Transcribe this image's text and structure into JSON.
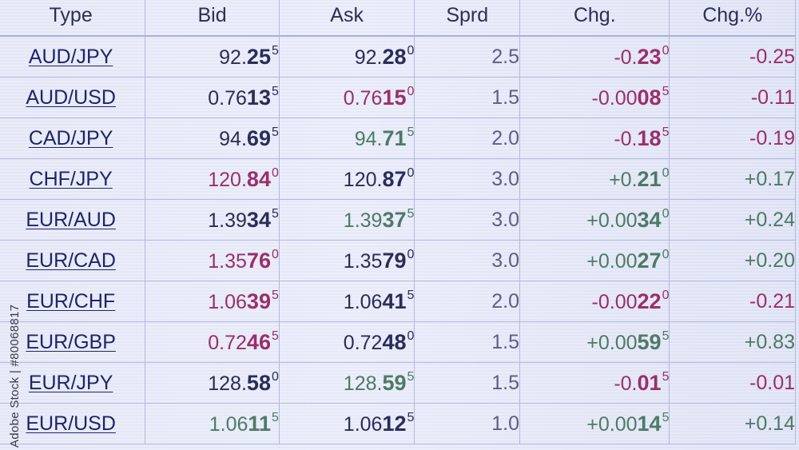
{
  "columns": [
    "Type",
    "Bid",
    "Ask",
    "Sprd",
    "Chg.",
    "Chg.%"
  ],
  "colors": {
    "dark": "#2a2d58",
    "magenta": "#9a2f6a",
    "green": "#4d7a66",
    "grey": "#5c5f84"
  },
  "rows": [
    {
      "type": "AUD/JPY",
      "bid": {
        "pre": "92.",
        "big": "25",
        "sup": "5",
        "color": "dark"
      },
      "ask": {
        "pre": "92.",
        "big": "28",
        "sup": "0",
        "color": "dark"
      },
      "sprd": "2.5",
      "chg": {
        "pre": "-0.",
        "big": "23",
        "sup": "0",
        "color": "magenta"
      },
      "pct": {
        "text": "-0.25",
        "color": "magenta"
      }
    },
    {
      "type": "AUD/USD",
      "bid": {
        "pre": "0.76",
        "big": "13",
        "sup": "5",
        "color": "dark"
      },
      "ask": {
        "pre": "0.76",
        "big": "15",
        "sup": "0",
        "color": "magenta"
      },
      "sprd": "1.5",
      "chg": {
        "pre": "-0.00",
        "big": "08",
        "sup": "5",
        "color": "magenta"
      },
      "pct": {
        "text": "-0.11",
        "color": "magenta"
      }
    },
    {
      "type": "CAD/JPY",
      "bid": {
        "pre": "94.",
        "big": "69",
        "sup": "5",
        "color": "dark"
      },
      "ask": {
        "pre": "94.",
        "big": "71",
        "sup": "5",
        "color": "green"
      },
      "sprd": "2.0",
      "chg": {
        "pre": "-0.",
        "big": "18",
        "sup": "5",
        "color": "magenta"
      },
      "pct": {
        "text": "-0.19",
        "color": "magenta"
      }
    },
    {
      "type": "CHF/JPY",
      "bid": {
        "pre": "120.",
        "big": "84",
        "sup": "0",
        "color": "magenta"
      },
      "ask": {
        "pre": "120.",
        "big": "87",
        "sup": "0",
        "color": "dark"
      },
      "sprd": "3.0",
      "chg": {
        "pre": "+0.",
        "big": "21",
        "sup": "0",
        "color": "green"
      },
      "pct": {
        "text": "+0.17",
        "color": "green"
      }
    },
    {
      "type": "EUR/AUD",
      "bid": {
        "pre": "1.39",
        "big": "34",
        "sup": "5",
        "color": "dark"
      },
      "ask": {
        "pre": "1.39",
        "big": "37",
        "sup": "5",
        "color": "green"
      },
      "sprd": "3.0",
      "chg": {
        "pre": "+0.00",
        "big": "34",
        "sup": "0",
        "color": "green"
      },
      "pct": {
        "text": "+0.24",
        "color": "green"
      }
    },
    {
      "type": "EUR/CAD",
      "bid": {
        "pre": "1.35",
        "big": "76",
        "sup": "0",
        "color": "magenta"
      },
      "ask": {
        "pre": "1.35",
        "big": "79",
        "sup": "0",
        "color": "dark"
      },
      "sprd": "3.0",
      "chg": {
        "pre": "+0.00",
        "big": "27",
        "sup": "0",
        "color": "green"
      },
      "pct": {
        "text": "+0.20",
        "color": "green"
      }
    },
    {
      "type": "EUR/CHF",
      "bid": {
        "pre": "1.06",
        "big": "39",
        "sup": "5",
        "color": "magenta"
      },
      "ask": {
        "pre": "1.06",
        "big": "41",
        "sup": "5",
        "color": "dark"
      },
      "sprd": "2.0",
      "chg": {
        "pre": "-0.00",
        "big": "22",
        "sup": "0",
        "color": "magenta"
      },
      "pct": {
        "text": "-0.21",
        "color": "magenta"
      }
    },
    {
      "type": "EUR/GBP",
      "bid": {
        "pre": "0.72",
        "big": "46",
        "sup": "5",
        "color": "magenta"
      },
      "ask": {
        "pre": "0.72",
        "big": "48",
        "sup": "0",
        "color": "dark"
      },
      "sprd": "1.5",
      "chg": {
        "pre": "+0.00",
        "big": "59",
        "sup": "5",
        "color": "green"
      },
      "pct": {
        "text": "+0.83",
        "color": "green"
      }
    },
    {
      "type": "EUR/JPY",
      "bid": {
        "pre": "128.",
        "big": "58",
        "sup": "0",
        "color": "dark"
      },
      "ask": {
        "pre": "128.",
        "big": "59",
        "sup": "5",
        "color": "green"
      },
      "sprd": "1.5",
      "chg": {
        "pre": "-0.",
        "big": "01",
        "sup": "5",
        "color": "magenta"
      },
      "pct": {
        "text": "-0.01",
        "color": "magenta"
      }
    },
    {
      "type": "EUR/USD",
      "bid": {
        "pre": "1.06",
        "big": "11",
        "sup": "5",
        "color": "green"
      },
      "ask": {
        "pre": "1.06",
        "big": "12",
        "sup": "5",
        "color": "dark"
      },
      "sprd": "1.0",
      "chg": {
        "pre": "+0.00",
        "big": "14",
        "sup": "5",
        "color": "green"
      },
      "pct": {
        "text": "+0.14",
        "color": "green"
      }
    }
  ],
  "watermark": "Adobe Stock | #80068817"
}
